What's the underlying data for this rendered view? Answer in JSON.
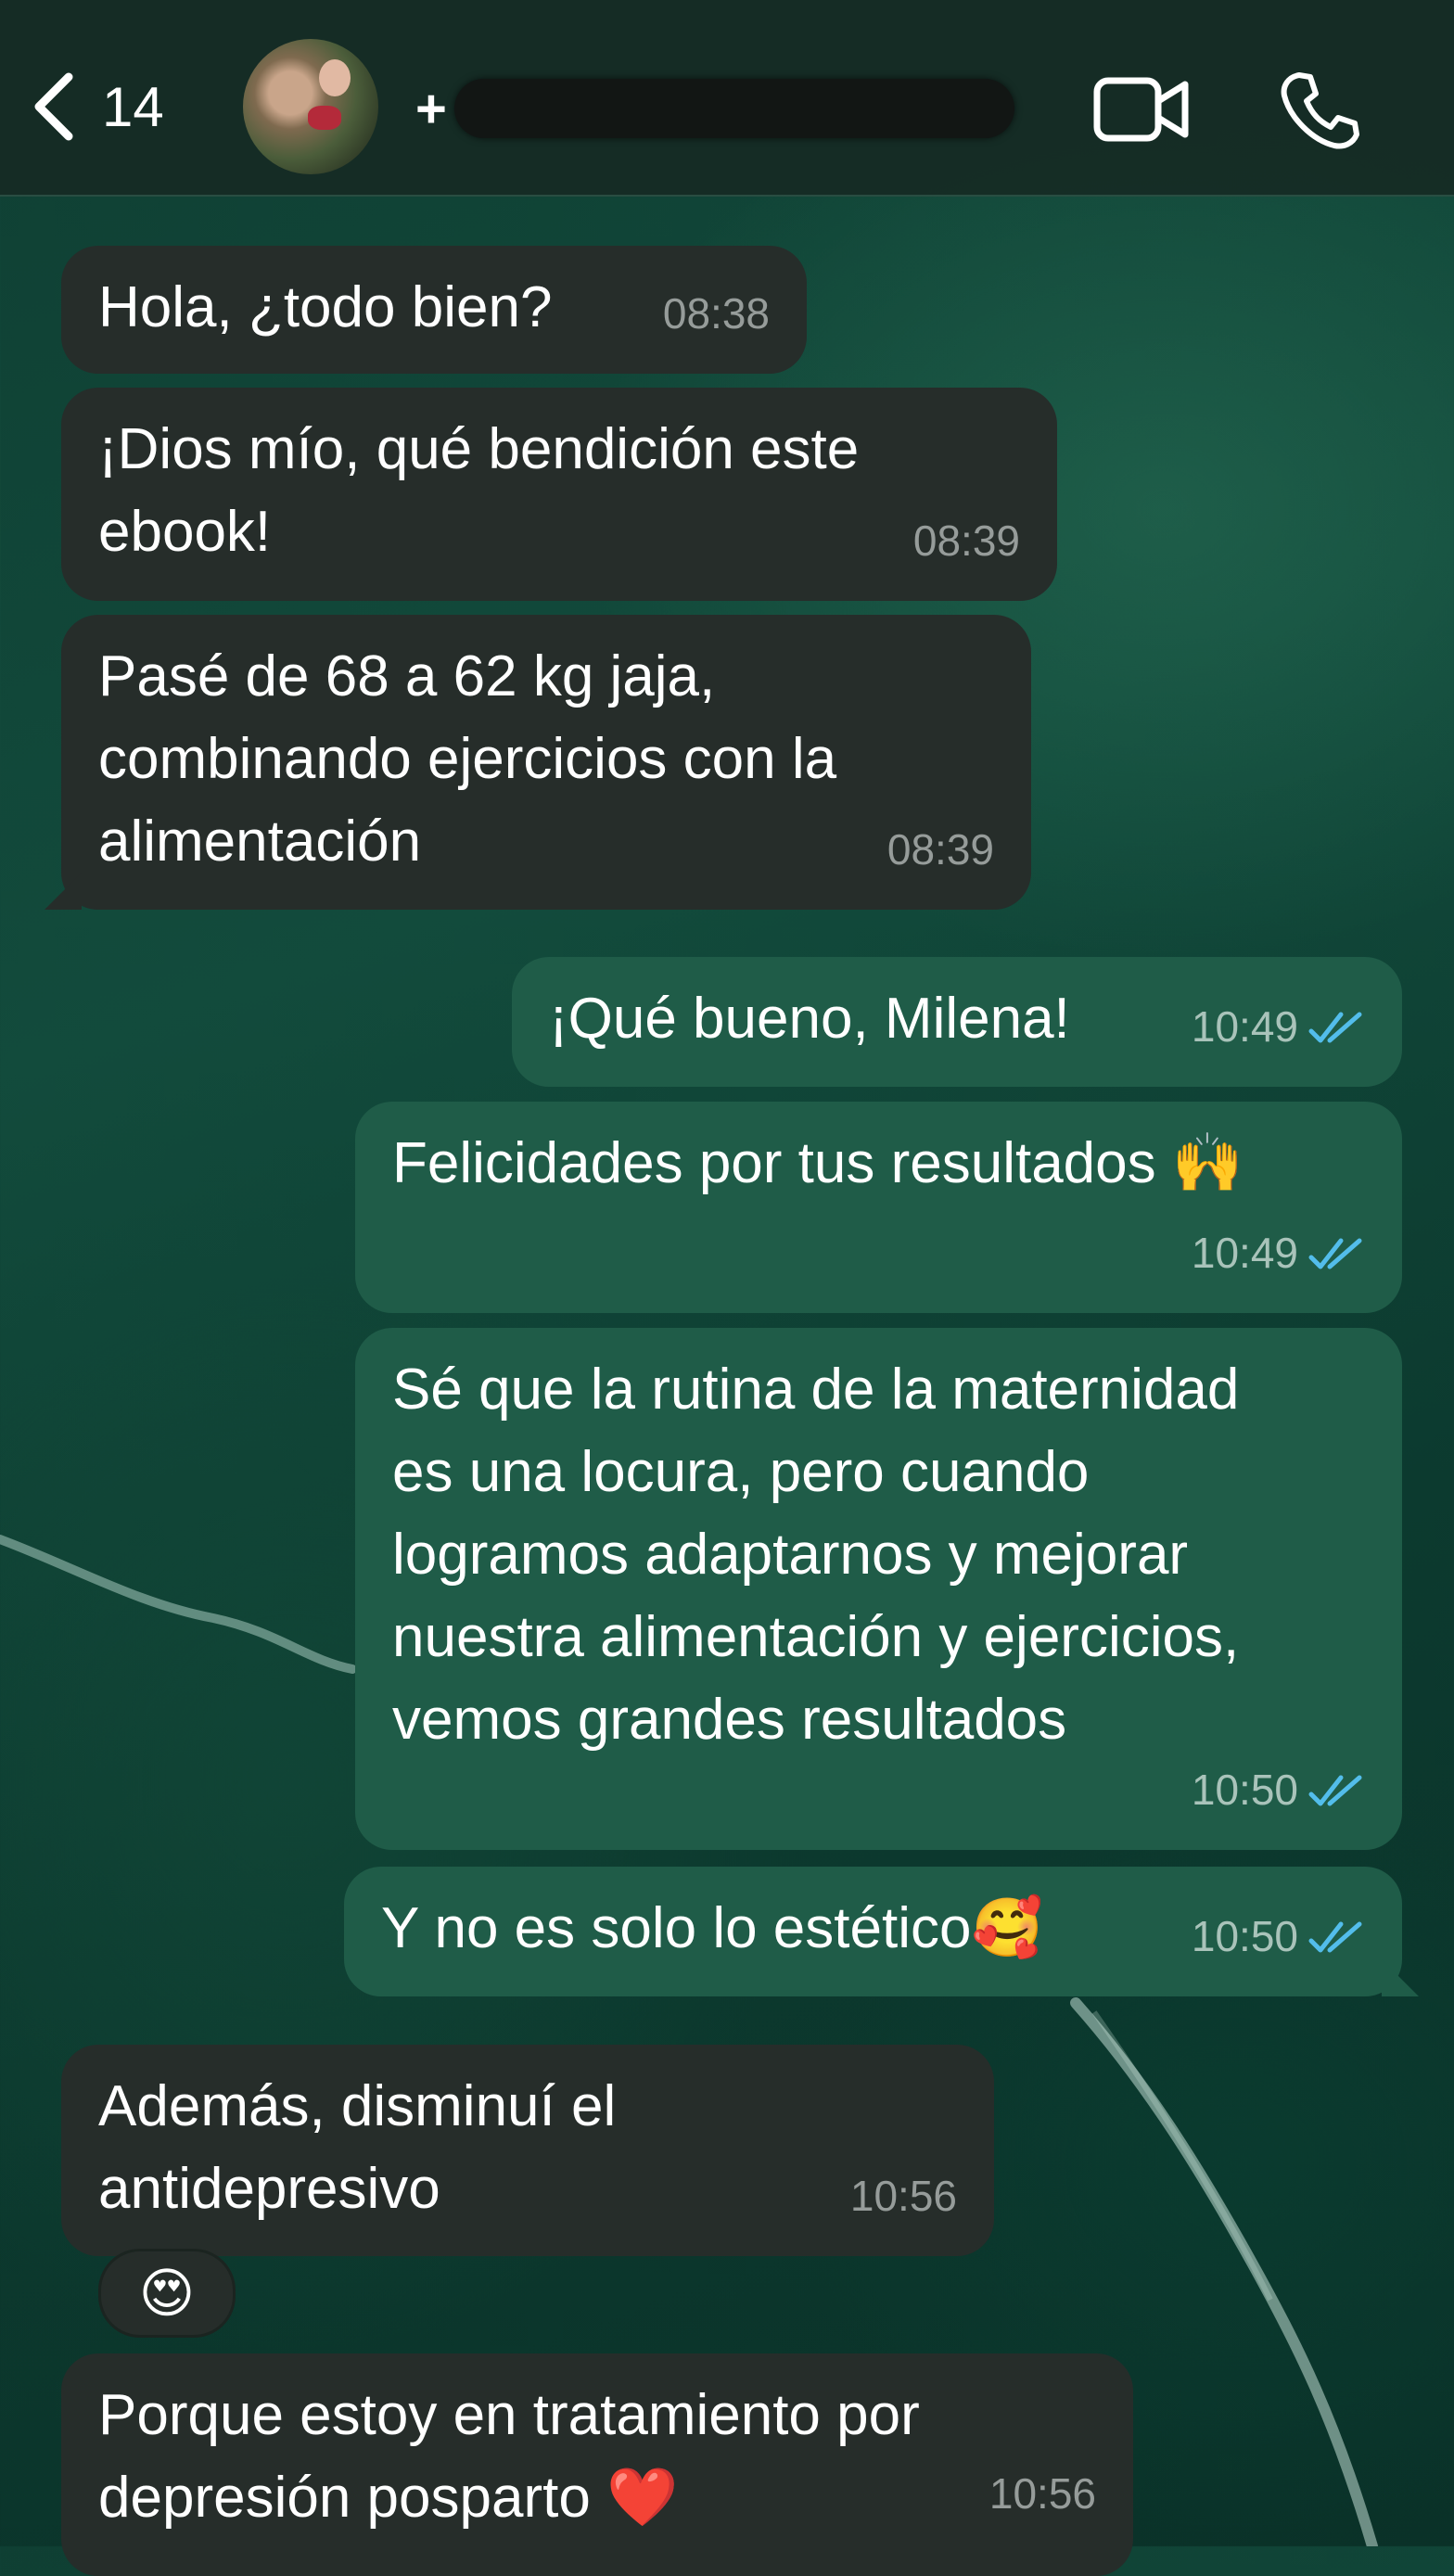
{
  "header": {
    "back_count": "14",
    "contact_visible_prefix": "+"
  },
  "messages": [
    {
      "direction": "incoming",
      "text": "Hola, ¿todo bien?",
      "time": "08:38"
    },
    {
      "direction": "incoming",
      "text": "¡Dios mío, qué bendición este\nebook!",
      "time": "08:39"
    },
    {
      "direction": "incoming",
      "text": "Pasé de 68 a 62 kg jaja,\ncombinando ejercicios con la\nalimentación",
      "time": "08:39"
    },
    {
      "direction": "outgoing",
      "text": "¡Qué bueno, Milena!",
      "time": "10:49",
      "status": "read"
    },
    {
      "direction": "outgoing",
      "text": "Felicidades por tus resultados 🙌",
      "time": "10:49",
      "status": "read"
    },
    {
      "direction": "outgoing",
      "text": "Sé que la rutina de la maternidad\nes una locura, pero cuando\nlogramos adaptarnos y mejorar\nnuestra alimentación y ejercicios,\nvemos grandes resultados",
      "time": "10:50",
      "status": "read"
    },
    {
      "direction": "outgoing",
      "text": "Y no es solo lo estético🥰",
      "time": "10:50",
      "status": "read"
    },
    {
      "direction": "incoming",
      "text": "Además, disminuí el\nantidepresivo",
      "time": "10:56",
      "reaction": "😍"
    },
    {
      "direction": "incoming",
      "text": "Porque estoy en tratamiento por\ndepresión posparto ❤️",
      "time": "10:56"
    }
  ],
  "colors": {
    "incoming_bubble": "#262d2a",
    "outgoing_bubble": "#1f5c48",
    "read_ticks": "#53bdeb",
    "header": "#162a24"
  },
  "icons": [
    "chevron-left-icon",
    "video-call-icon",
    "phone-icon",
    "double-check-icon"
  ]
}
